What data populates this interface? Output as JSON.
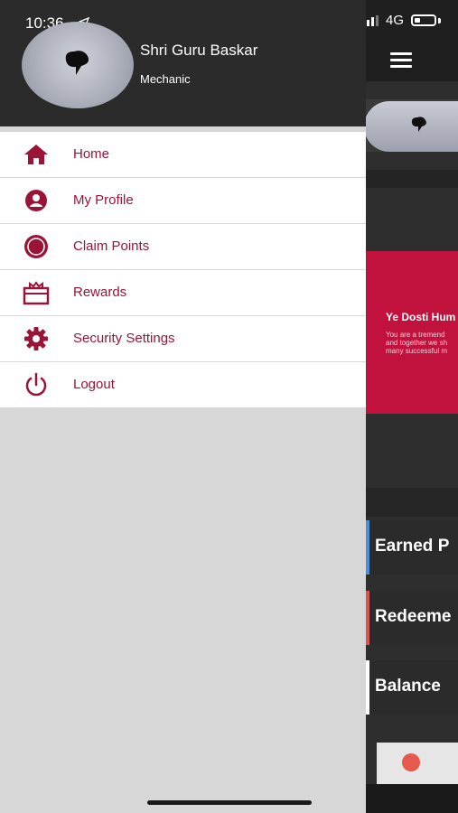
{
  "status_bar": {
    "time": "10:36",
    "network": "4G"
  },
  "drawer": {
    "user_name": "Shri Guru Baskar",
    "user_role": "Mechanic",
    "menu": [
      {
        "label": "Home",
        "icon": "home-icon"
      },
      {
        "label": "My Profile",
        "icon": "user-circle-icon"
      },
      {
        "label": "Claim Points",
        "icon": "badge-icon"
      },
      {
        "label": "Rewards",
        "icon": "gift-icon"
      },
      {
        "label": "Security Settings",
        "icon": "gear-icon"
      },
      {
        "label": "Logout",
        "icon": "power-icon"
      }
    ]
  },
  "background_app": {
    "banner_title": "Ye Dosti Hum",
    "banner_text_1": "You are a tremend",
    "banner_text_2": "and together we sh",
    "banner_text_3": "many successful m",
    "rows": [
      {
        "label": "Earned P",
        "color": "#4a90d9"
      },
      {
        "label": "Redeeme",
        "color": "#d9534f"
      },
      {
        "label": "Balance",
        "color": "#ffffff"
      }
    ]
  },
  "colors": {
    "accent": "#9a1438",
    "banner": "#c1123d",
    "header": "#2b2b2b"
  }
}
